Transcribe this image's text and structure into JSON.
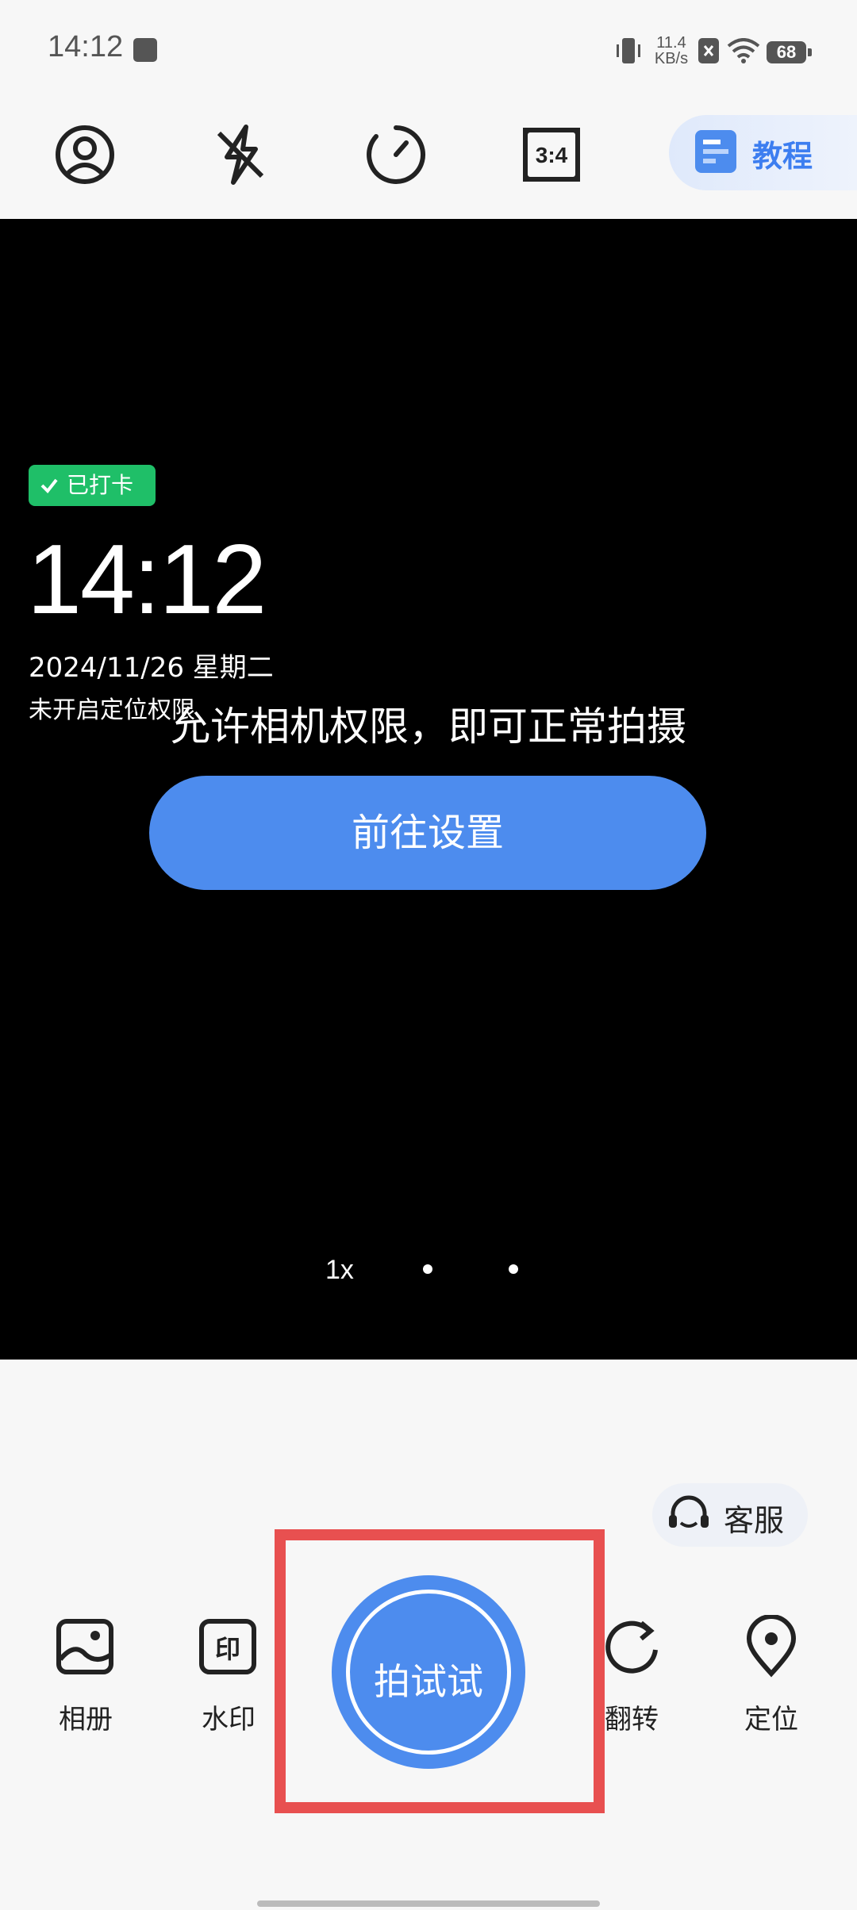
{
  "status_bar": {
    "time": "14:12",
    "net_speed_value": "11.4",
    "net_speed_unit": "KB/s",
    "battery": "68"
  },
  "toolbar": {
    "tutorial_label": "教程"
  },
  "viewfinder": {
    "checked_badge": "已打卡",
    "time": "14:12",
    "date": "2024/11/26 星期二",
    "location": "未开启定位权限",
    "permission_message": "允许相机权限，即可正常拍摄",
    "goto_settings_label": "前往设置",
    "zoom_label": "1x"
  },
  "bottom": {
    "service_label": "客服",
    "album_label": "相册",
    "watermark_label": "水印",
    "shutter_label": "拍试试",
    "flip_label": "翻转",
    "location_label": "定位"
  },
  "colors": {
    "accent": "#4d8cee",
    "checked": "#1fbf68",
    "highlight": "#e85050"
  }
}
